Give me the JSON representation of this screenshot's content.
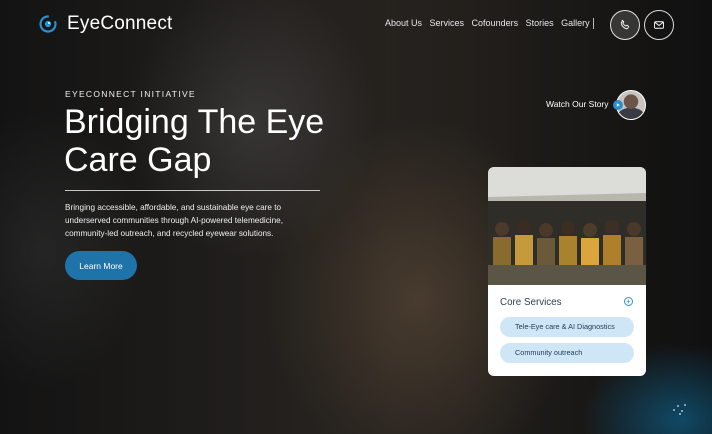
{
  "brand": {
    "name": "EyeConnect",
    "logo_icon": "eye-logo-icon",
    "accent": "#1e73a8"
  },
  "nav": {
    "links": [
      "About Us",
      "Services",
      "Cofounders",
      "Stories",
      "Gallery"
    ],
    "icons": [
      "phone-icon",
      "mail-icon"
    ]
  },
  "hero": {
    "eyebrow": "EYECONNECT INITIATIVE",
    "headline": "Bridging The Eye Care Gap",
    "description": "Bringing accessible, affordable, and sustainable eye care to underserved communities through AI-powered telemedicine, community-led outreach, and recycled eyewear solutions.",
    "cta_label": "Learn More",
    "watch_label": "Watch Our Story"
  },
  "card": {
    "title": "Core Services",
    "services": [
      "Tele-Eye care & AI Diagnostics",
      "Community outreach"
    ],
    "pill_color": "#cfe6f7"
  }
}
